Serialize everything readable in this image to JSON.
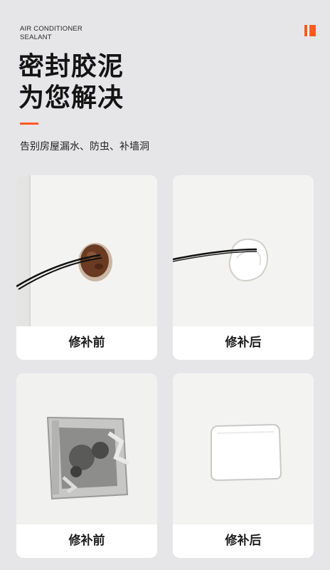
{
  "header": {
    "eyebrow_line1": "AIR CONDITIONER",
    "eyebrow_line2": "SEALANT",
    "headline_line1": "密封胶泥",
    "headline_line2": "为您解决",
    "subtitle": "告别房屋漏水、防虫、补墙洞"
  },
  "colors": {
    "accent": "#ff5a1f",
    "background": "#e6e6e9",
    "card": "#ffffff"
  },
  "cards": [
    {
      "label": "修补前"
    },
    {
      "label": "修补后"
    },
    {
      "label": "修补前"
    },
    {
      "label": "修补后"
    }
  ]
}
